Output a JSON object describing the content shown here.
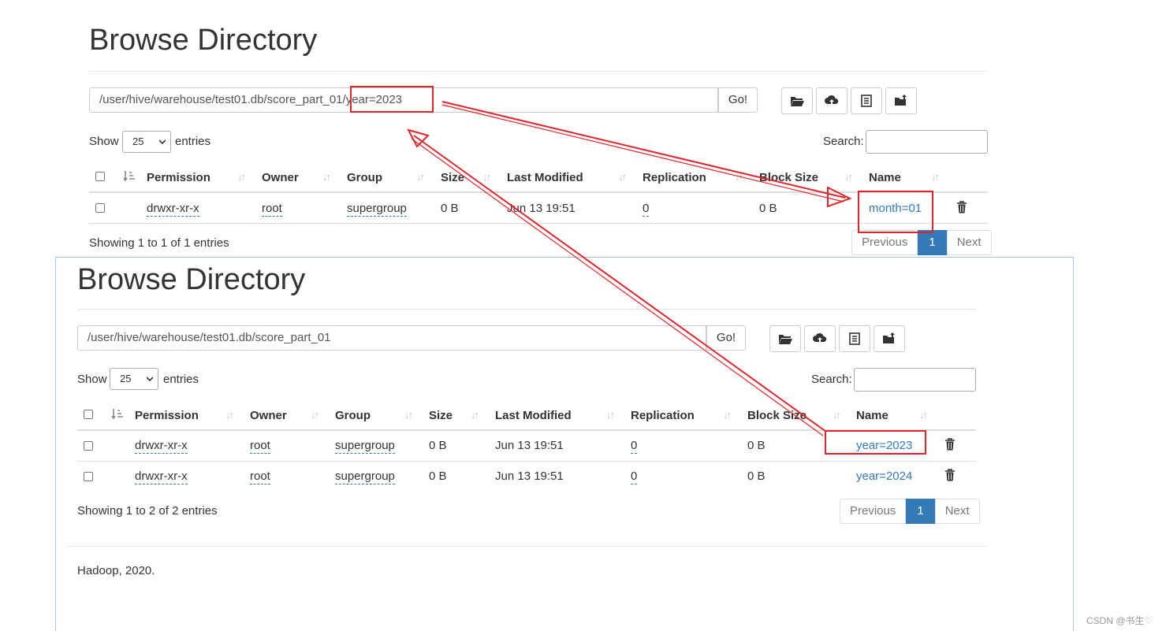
{
  "top": {
    "title": "Browse Directory",
    "path": "/user/hive/warehouse/test01.db/score_part_01/year=2023",
    "go": "Go!",
    "show": "Show",
    "entries_select": "25",
    "entries": "entries",
    "search_label": "Search:",
    "headers": [
      "Permission",
      "Owner",
      "Group",
      "Size",
      "Last Modified",
      "Replication",
      "Block Size",
      "Name"
    ],
    "rows": [
      {
        "permission": "drwxr-xr-x",
        "owner": "root",
        "group": "supergroup",
        "size": "0 B",
        "modified": "Jun 13 19:51",
        "replication": "0",
        "block_size": "0 B",
        "name": "month=01"
      }
    ],
    "info": "Showing 1 to 1 of 1 entries",
    "pager": {
      "prev": "Previous",
      "page": "1",
      "next": "Next"
    }
  },
  "bottom": {
    "title": "Browse Directory",
    "path": "/user/hive/warehouse/test01.db/score_part_01",
    "go": "Go!",
    "show": "Show",
    "entries_select": "25",
    "entries": "entries",
    "search_label": "Search:",
    "headers": [
      "Permission",
      "Owner",
      "Group",
      "Size",
      "Last Modified",
      "Replication",
      "Block Size",
      "Name"
    ],
    "rows": [
      {
        "permission": "drwxr-xr-x",
        "owner": "root",
        "group": "supergroup",
        "size": "0 B",
        "modified": "Jun 13 19:51",
        "replication": "0",
        "block_size": "0 B",
        "name": "year=2023"
      },
      {
        "permission": "drwxr-xr-x",
        "owner": "root",
        "group": "supergroup",
        "size": "0 B",
        "modified": "Jun 13 19:51",
        "replication": "0",
        "block_size": "0 B",
        "name": "year=2024"
      }
    ],
    "info": "Showing 1 to 2 of 2 entries",
    "pager": {
      "prev": "Previous",
      "page": "1",
      "next": "Next"
    },
    "footer": "Hadoop, 2020."
  },
  "watermark": "CSDN @书生♡",
  "colors": {
    "link": "#337ab7",
    "annotation": "#e0242b",
    "active_page": "#337ab7"
  },
  "icons": [
    "folder-open-icon",
    "cloud-upload-icon",
    "list-icon",
    "folder-upload-icon",
    "sort-icon",
    "trash-icon"
  ]
}
